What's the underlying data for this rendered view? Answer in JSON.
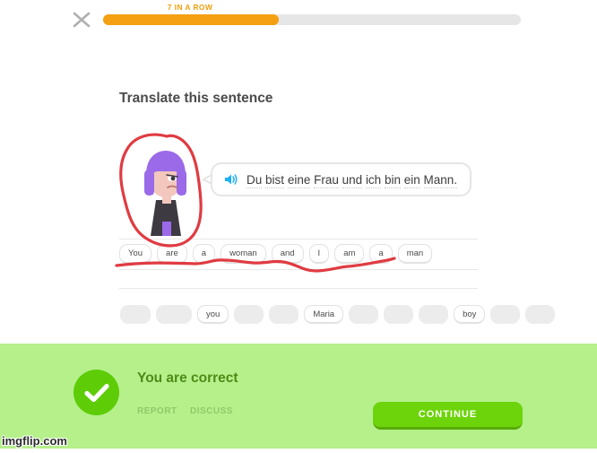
{
  "topbar": {
    "close_icon": "close-x-icon",
    "streak_label": "7 IN A ROW",
    "progress_percent": 42,
    "progress_color": "#f5a012",
    "track_color": "#e6e6e6"
  },
  "exercise": {
    "title": "Translate this sentence",
    "speaker_icon": "speaker-volume-icon",
    "sentence_words": [
      "Du",
      "bist",
      "eine",
      "Frau",
      "und",
      "ich",
      "bin",
      "ein",
      "Mann."
    ],
    "sentence": "Du bist eine Frau und ich bin ein Mann.",
    "answer_tiles": [
      "You",
      "are",
      "a",
      "woman",
      "and",
      "I",
      "am",
      "a",
      "man"
    ],
    "word_bank": [
      {
        "label": "",
        "used": true
      },
      {
        "label": "",
        "used": true
      },
      {
        "label": "you",
        "used": false
      },
      {
        "label": "",
        "used": true
      },
      {
        "label": "",
        "used": true
      },
      {
        "label": "Maria",
        "used": false
      },
      {
        "label": "",
        "used": true
      },
      {
        "label": "",
        "used": true
      },
      {
        "label": "",
        "used": true
      },
      {
        "label": "boy",
        "used": false
      },
      {
        "label": "",
        "used": true
      },
      {
        "label": "",
        "used": true
      }
    ]
  },
  "character": {
    "name": "duolingo-character-avatar",
    "hair_color": "#9a6ae8",
    "skin_color": "#f3c7bd",
    "shirt_color": "#3e3a42"
  },
  "result": {
    "check_icon": "check-mark-icon",
    "message": "You are correct",
    "message_color": "#4e8b17",
    "banner_color": "#b5f08b",
    "report_label": "REPORT",
    "discuss_label": "DISCUSS",
    "continue_label": "CONTINUE",
    "continue_color": "#6dd40b"
  },
  "annotations": {
    "marker_color": "#e03b42",
    "circle_around": "character",
    "underline_under": "answer_tiles"
  },
  "watermark": {
    "text": "imgflip.com"
  }
}
